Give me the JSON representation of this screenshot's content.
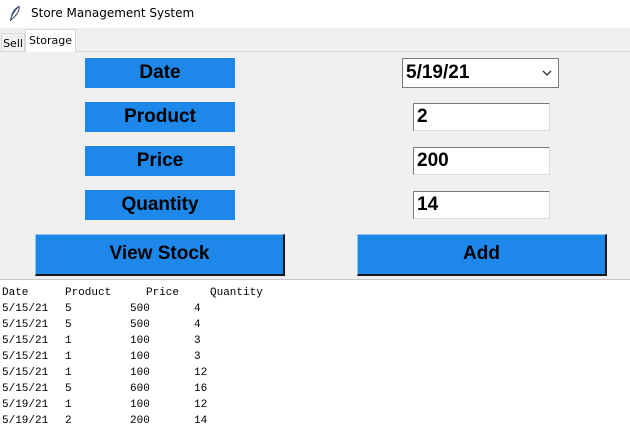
{
  "window": {
    "title": "Store Management System"
  },
  "tabs": [
    {
      "label": "Sell",
      "active": false
    },
    {
      "label": "Storage",
      "active": true
    }
  ],
  "form": {
    "date_label": "Date",
    "product_label": "Product",
    "price_label": "Price",
    "quantity_label": "Quantity",
    "date_value": "5/19/21",
    "product_value": "2",
    "price_value": "200",
    "quantity_value": "14"
  },
  "buttons": {
    "view_stock": "View Stock",
    "add": "Add"
  },
  "stock_list": {
    "headers": [
      "Date",
      "Product",
      "Price",
      "Quantity"
    ],
    "rows": [
      [
        "5/15/21",
        "5",
        "500",
        "4"
      ],
      [
        "5/15/21",
        "5",
        "500",
        "4"
      ],
      [
        "5/15/21",
        "1",
        "100",
        "3"
      ],
      [
        "5/15/21",
        "1",
        "100",
        "3"
      ],
      [
        "5/15/21",
        "1",
        "100",
        "12"
      ],
      [
        "5/15/21",
        "5",
        "600",
        "16"
      ],
      [
        "5/19/21",
        "1",
        "100",
        "12"
      ],
      [
        "5/19/21",
        "2",
        "200",
        "14"
      ]
    ]
  },
  "colors": {
    "accent": "#1e88ea",
    "window_bg": "#f0f0f0"
  },
  "icons": {
    "app": "feather-icon",
    "dropdown": "chevron-down-icon"
  }
}
